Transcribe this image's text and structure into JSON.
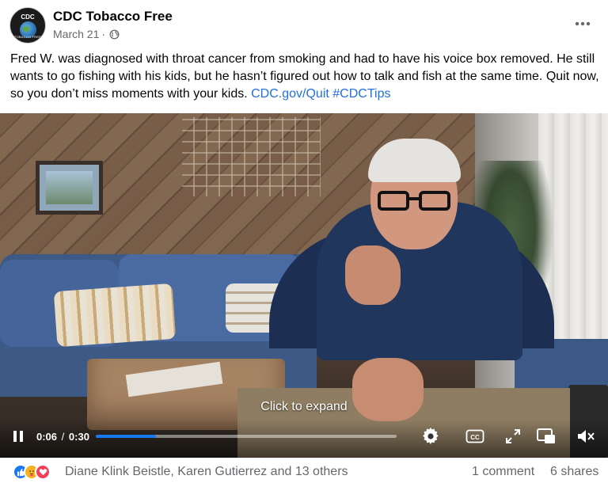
{
  "post": {
    "page_name": "CDC Tobacco Free",
    "date": "March 21",
    "date_separator": "·",
    "privacy_icon": "globe-icon",
    "more_icon": "more-options-icon",
    "avatar": {
      "top_text": "CDC",
      "bottom_text": "TOBACCO FREE",
      "icon": "globe-logo"
    },
    "text": "Fred W. was diagnosed with throat cancer from smoking and had to have his voice box removed. He still wants to go fishing with his kids, but he hasn’t figured out how to talk and fish at the same time. Quit now, so you don’t miss moments with your kids.",
    "link_text": "CDC.gov/Quit",
    "hashtag": "#CDCTips",
    "link_color": "#216fdb"
  },
  "video": {
    "expand_label": "Click to expand",
    "current_time": "0:06",
    "time_separator": "/",
    "duration": "0:30",
    "progress_fraction": 0.2,
    "progress_color": "#1877f2",
    "icons": [
      "pause-icon",
      "settings-icon",
      "captions-icon",
      "fullscreen-icon",
      "picture-in-picture-icon",
      "mute-icon"
    ]
  },
  "engagement": {
    "reaction_icons": [
      "like-icon",
      "care-icon",
      "love-icon"
    ],
    "reactors": "Diane Klink Beistle, Karen Gutierrez and 13 others",
    "comments": "1 comment",
    "shares": "6 shares"
  }
}
